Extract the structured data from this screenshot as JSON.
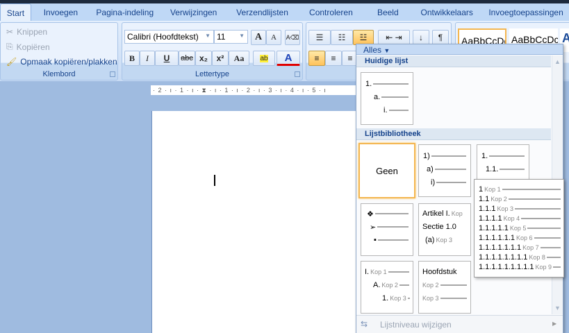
{
  "tabs": [
    "Start",
    "Invoegen",
    "Pagina-indeling",
    "Verwijzingen",
    "Verzendlijsten",
    "Controleren",
    "Beeld",
    "Ontwikkelaars",
    "Invoegtoepassingen"
  ],
  "clipboard": {
    "cut": "Knippen",
    "copy": "Kopiëren",
    "format_painter": "Opmaak kopiëren/plakken",
    "label": "Klembord"
  },
  "font": {
    "name": "Calibri (Hoofdtekst)",
    "size": "11",
    "label": "Lettertype",
    "bold": "B",
    "italic": "I",
    "underline": "U",
    "strike": "abc",
    "sub": "x₂",
    "sup": "x²",
    "case": "Aa",
    "grow": "A",
    "shrink": "A",
    "color_accent": "#e00000"
  },
  "styles": [
    "AaBbCcDc",
    "AaBbCcDc",
    "A"
  ],
  "ruler": "· 2 · ı · 1 · ı · ⧗ · ı · 1 · ı · 2 · ı · 3 · ı · 4 · ı · 5 · ı",
  "menu": {
    "filter": "Alles",
    "current_heading": "Huidige lijst",
    "current_list": [
      "1.",
      "a.",
      "i."
    ],
    "library_heading": "Lijstbibliotheek",
    "none_label": "Geen",
    "list2": [
      "1)",
      "a)",
      "i)"
    ],
    "list3": [
      "1.",
      "1.1."
    ],
    "list5": [
      "Artikel I.",
      "Sectie 1.0",
      "(a)"
    ],
    "list5_kop": [
      "Kop",
      "",
      "Kop 3"
    ],
    "list6": [
      {
        "n": "I.",
        "k": "Kop 1"
      },
      {
        "n": "A.",
        "k": "Kop 2"
      },
      {
        "n": "1.",
        "k": "Kop 3"
      }
    ],
    "list7": {
      "title": "Hoofdstuk",
      "k2": "Kop 2",
      "k3": "Kop 3"
    },
    "footer": "Lijstniveau wijzigen"
  },
  "tooltip": [
    {
      "n": "1",
      "k": "Kop 1"
    },
    {
      "n": "1.1",
      "k": "Kop 2"
    },
    {
      "n": "1.1.1",
      "k": "Kop 3"
    },
    {
      "n": "1.1.1.1",
      "k": "Kop 4"
    },
    {
      "n": "1.1.1.1.1",
      "k": "Kop 5"
    },
    {
      "n": "1.1.1.1.1.1",
      "k": "Kop 6"
    },
    {
      "n": "1.1.1.1.1.1.1",
      "k": "Kop 7"
    },
    {
      "n": "1.1.1.1.1.1.1.1",
      "k": "Kop 8"
    },
    {
      "n": "1.1.1.1.1.1.1.1.1",
      "k": "Kop 9"
    }
  ]
}
